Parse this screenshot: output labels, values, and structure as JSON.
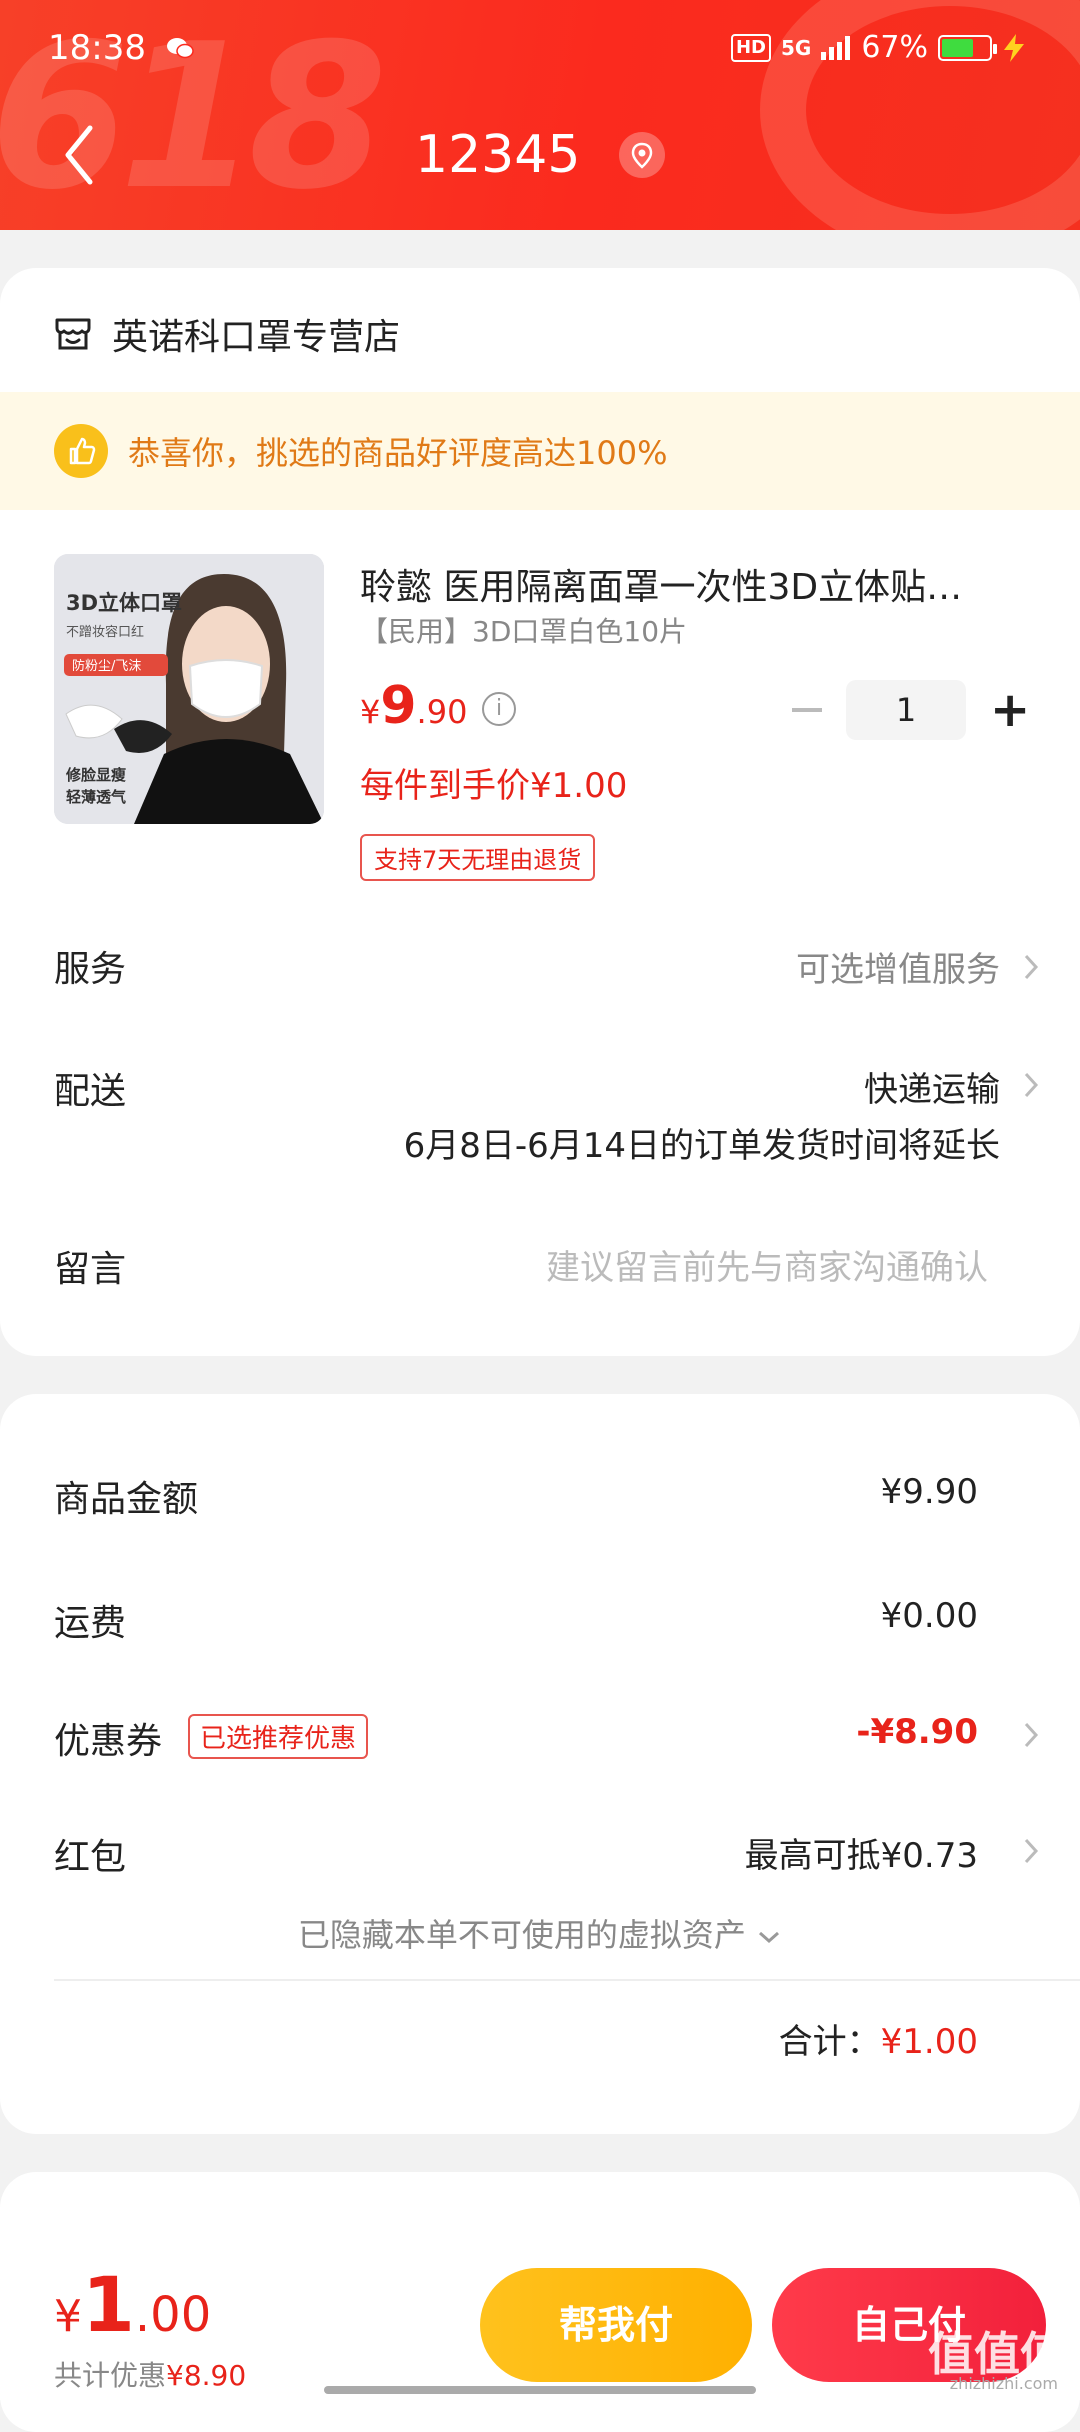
{
  "status_bar": {
    "time": "18:38",
    "hd": "HD",
    "network": "5G",
    "battery": "67%",
    "battery_level": 0.67
  },
  "header": {
    "title": "12345"
  },
  "store": {
    "name": "英诺科口罩专营店"
  },
  "banner": {
    "text": "恭喜你，挑选的商品好评度高达100%"
  },
  "product": {
    "title": "聆懿 医用隔离面罩一次性3D立体贴…",
    "sku": "【民用】3D口罩白色10片",
    "price_symbol": "¥",
    "price_int": "9",
    "price_dec": ".90",
    "quantity": "1",
    "unit_price": "每件到手价¥1.00",
    "return_tag": "支持7天无理由退货",
    "image_texts": [
      "3D立体口罩",
      "不蹭妆容口红",
      "防粉尘/飞沫",
      "修脸显瘦",
      "轻薄透气"
    ]
  },
  "rows": {
    "service": {
      "label": "服务",
      "value": "可选增值服务"
    },
    "delivery": {
      "label": "配送",
      "value": "快递运输",
      "note": "6月8日-6月14日的订单发货时间将延长"
    },
    "message": {
      "label": "留言",
      "placeholder": "建议留言前先与商家沟通确认"
    }
  },
  "summary": {
    "goods": {
      "label": "商品金额",
      "value": "¥9.90"
    },
    "shipping": {
      "label": "运费",
      "value": "¥0.00"
    },
    "coupon": {
      "label": "优惠券",
      "tag": "已选推荐优惠",
      "value": "-¥8.90"
    },
    "redpacket": {
      "label": "红包",
      "value": "最高可抵¥0.73"
    },
    "hidden_note": "已隐藏本单不可使用的虚拟资产",
    "total_label": "合计：",
    "total_value": "¥1.00"
  },
  "bottom": {
    "yen": "¥",
    "int": "1",
    "dec": ".00",
    "saving_label": "共计优惠",
    "saving_value": "¥8.90",
    "pay_for_me": "帮我付",
    "pay_self": "自己付"
  },
  "watermark": {
    "logo": "值值值",
    "site": "zhizhizhi.com"
  },
  "colors": {
    "accent": "#e8231a",
    "header": "#fb2a1e",
    "banner_text": "#e07a17",
    "pay_for_me": "#ffb800",
    "pay_self": "#f2203b"
  }
}
